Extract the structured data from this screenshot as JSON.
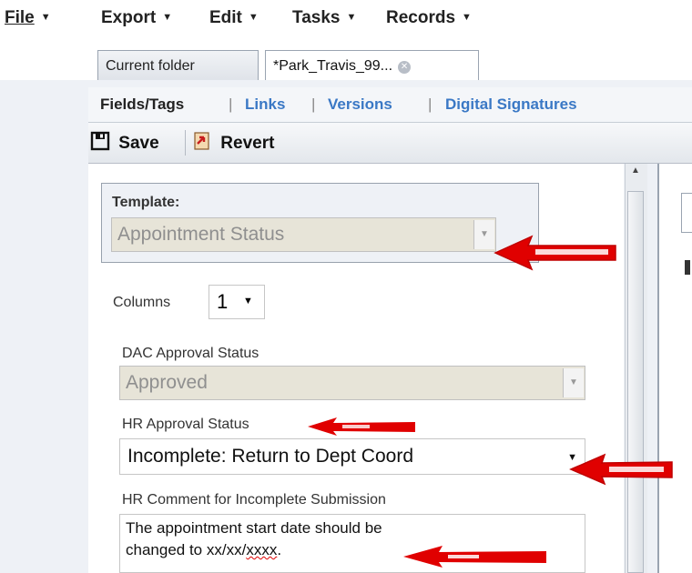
{
  "menu": [
    {
      "label": "File"
    },
    {
      "label": "Export"
    },
    {
      "label": "Edit"
    },
    {
      "label": "Tasks"
    },
    {
      "label": "Records"
    }
  ],
  "tabs": {
    "current_folder": "Current folder",
    "record": "*Park_Travis_99..."
  },
  "subnav": {
    "fields_tags": "Fields/Tags",
    "sep": "|",
    "links": "Links",
    "versions": "Versions",
    "digital_signatures": "Digital Signatures"
  },
  "toolbar": {
    "save": "Save",
    "revert": "Revert"
  },
  "form": {
    "template_label": "Template:",
    "template_value": "Appointment Status",
    "columns_label": "Columns",
    "columns_value": "1",
    "dac_label": "DAC Approval Status",
    "dac_value": "Approved",
    "hr_label": "HR Approval Status",
    "hr_value": "Incomplete: Return to Dept Coord",
    "comment_label": "HR Comment for Incomplete Submission",
    "comment_line1": "The appointment start date should be",
    "comment_line2_prefix": "changed to xx/xx/",
    "comment_line2_squiggle": "xxxx",
    "comment_line2_suffix": "."
  },
  "colors": {
    "link": "#3a78c5",
    "annotation_red": "#e00000"
  },
  "icons": [
    "caret-down-icon",
    "close-tab-icon",
    "save-icon",
    "revert-icon",
    "scroll-up-arrow-icon"
  ]
}
